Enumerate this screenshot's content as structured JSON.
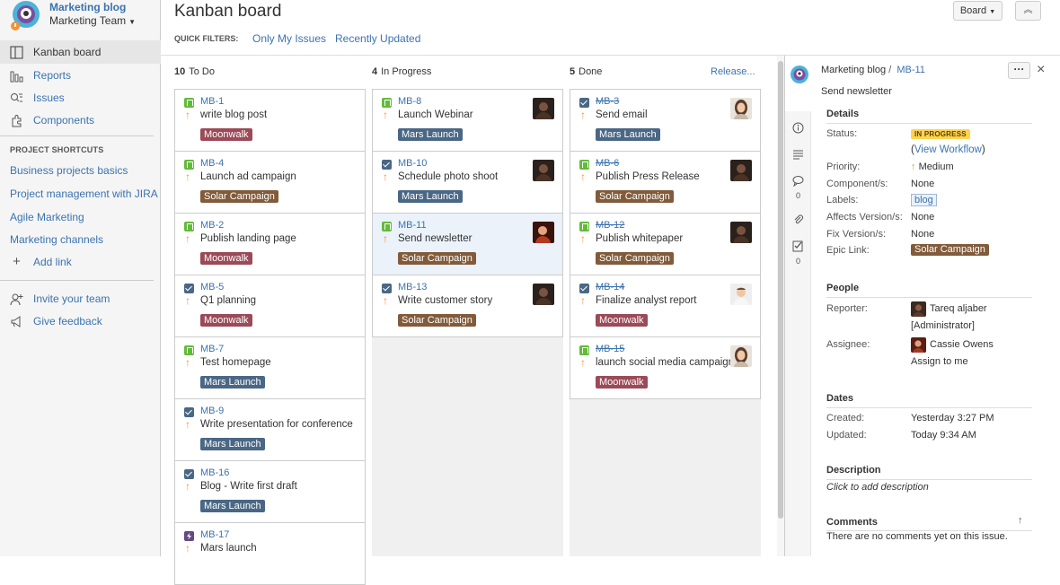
{
  "sidebar": {
    "project_name": "Marketing blog",
    "team": "Marketing Team",
    "nav": [
      {
        "label": "Kanban board",
        "icon": "board-icon",
        "active": true
      },
      {
        "label": "Reports",
        "icon": "reports-icon",
        "active": false
      },
      {
        "label": "Issues",
        "icon": "issues-icon",
        "active": false
      },
      {
        "label": "Components",
        "icon": "components-icon",
        "active": false
      }
    ],
    "shortcuts_title": "PROJECT SHORTCUTS",
    "shortcuts": [
      "Business projects basics",
      "Project management with JIRA",
      "Agile Marketing",
      "Marketing channels"
    ],
    "add_link": "Add link",
    "invite": "Invite your team",
    "feedback": "Give feedback"
  },
  "header": {
    "title": "Kanban board",
    "quick_filters_label": "QUICK FILTERS:",
    "filters": [
      "Only My Issues",
      "Recently Updated"
    ],
    "board_button": "Board"
  },
  "columns": [
    {
      "count": "10",
      "name": "To Do",
      "cards": [
        {
          "key": "MB-1",
          "type": "story",
          "summary": "write blog post",
          "epic": "Moonwalk",
          "done": false
        },
        {
          "key": "MB-4",
          "type": "story",
          "summary": "Launch ad campaign",
          "epic": "Solar Campaign",
          "done": false
        },
        {
          "key": "MB-2",
          "type": "story",
          "summary": "Publish landing page",
          "epic": "Moonwalk",
          "done": false
        },
        {
          "key": "MB-5",
          "type": "task",
          "summary": "Q1 planning",
          "epic": "Moonwalk",
          "done": false
        },
        {
          "key": "MB-7",
          "type": "story",
          "summary": "Test homepage",
          "epic": "Mars Launch",
          "done": false
        },
        {
          "key": "MB-9",
          "type": "task",
          "summary": "Write presentation for conference",
          "epic": "Mars Launch",
          "done": false
        },
        {
          "key": "MB-16",
          "type": "task",
          "summary": "Blog - Write first draft",
          "epic": "Mars Launch",
          "done": false
        },
        {
          "key": "MB-17",
          "type": "epic",
          "summary": "Mars launch",
          "epic": "",
          "done": false
        }
      ]
    },
    {
      "count": "4",
      "name": "In Progress",
      "cards": [
        {
          "key": "MB-8",
          "type": "story",
          "summary": "Launch Webinar",
          "epic": "Mars Launch",
          "done": false,
          "avatar": "dark"
        },
        {
          "key": "MB-10",
          "type": "task",
          "summary": "Schedule photo shoot",
          "epic": "Mars Launch",
          "done": false,
          "avatar": "dark"
        },
        {
          "key": "MB-11",
          "type": "story",
          "summary": "Send newsletter",
          "epic": "Solar Campaign",
          "done": false,
          "avatar": "red",
          "selected": true
        },
        {
          "key": "MB-13",
          "type": "task",
          "summary": "Write customer story",
          "epic": "Solar Campaign",
          "done": false,
          "avatar": "dark"
        }
      ]
    },
    {
      "count": "5",
      "name": "Done",
      "release": "Release...",
      "cards": [
        {
          "key": "MB-3",
          "type": "task",
          "summary": "Send email",
          "epic": "Mars Launch",
          "done": true,
          "avatar": "woman"
        },
        {
          "key": "MB-6",
          "type": "story",
          "summary": "Publish Press Release",
          "epic": "Solar Campaign",
          "done": true,
          "avatar": "dark"
        },
        {
          "key": "MB-12",
          "type": "story",
          "summary": "Publish whitepaper",
          "epic": "Solar Campaign",
          "done": true,
          "avatar": "dark"
        },
        {
          "key": "MB-14",
          "type": "task",
          "summary": "Finalize analyst report",
          "epic": "Moonwalk",
          "done": true,
          "avatar": "light"
        },
        {
          "key": "MB-15",
          "type": "story",
          "summary": "launch social media campaign",
          "epic": "Moonwalk",
          "done": true,
          "avatar": "woman"
        }
      ]
    }
  ],
  "epic_colors": {
    "Moonwalk": "#9b4a57",
    "Solar Campaign": "#815b3a",
    "Mars Launch": "#4a6785"
  },
  "detail": {
    "project": "Marketing blog",
    "separator": "/",
    "key": "MB-11",
    "summary": "Send newsletter",
    "more_button": "···",
    "close_button": "×",
    "comment_count": "0",
    "subtask_count": "0",
    "details_title": "Details",
    "status_label": "Status:",
    "status": "IN PROGRESS",
    "workflow_open": "(",
    "workflow_link": "View Workflow",
    "workflow_close": ")",
    "priority_label": "Priority:",
    "priority": "Medium",
    "components_label": "Component/s:",
    "components": "None",
    "labels_label": "Labels:",
    "labels": "blog",
    "affects_label": "Affects Version/s:",
    "affects": "None",
    "fix_label": "Fix Version/s:",
    "fix": "None",
    "epic_label": "Epic Link:",
    "epic": "Solar Campaign",
    "people_title": "People",
    "reporter_label": "Reporter:",
    "reporter": "Tareq aljaber",
    "reporter_role": "[Administrator]",
    "assignee_label": "Assignee:",
    "assignee": "Cassie Owens",
    "assign_to_me": "Assign to me",
    "dates_title": "Dates",
    "created_label": "Created:",
    "created": "Yesterday 3:27 PM",
    "updated_label": "Updated:",
    "updated": "Today 9:34 AM",
    "description_title": "Description",
    "description_placeholder": "Click to add description",
    "comments_title": "Comments",
    "comments_empty": "There are no comments yet on this issue."
  }
}
